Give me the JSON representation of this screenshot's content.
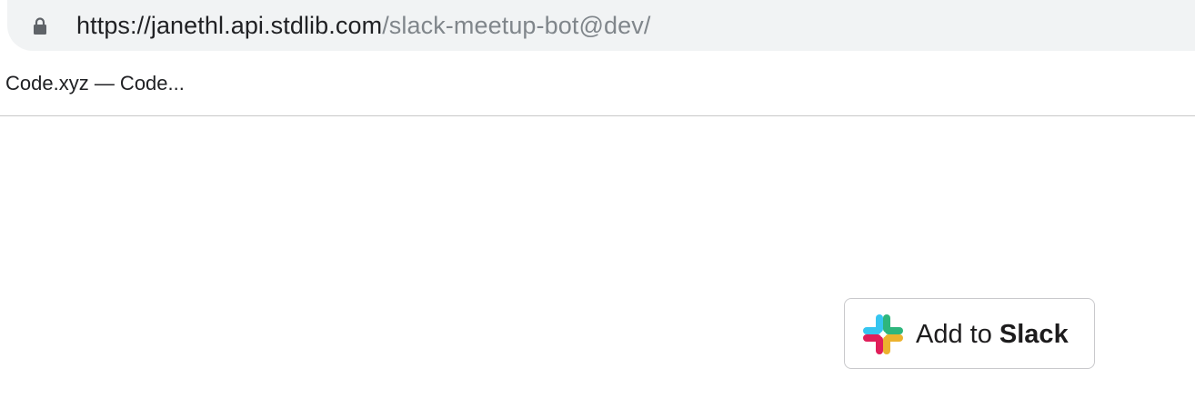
{
  "browser": {
    "url_host": "https://janethl.api.stdlib.com",
    "url_path": "/slack-meetup-bot@dev/",
    "lock_icon": "lock-icon"
  },
  "bookmarks": {
    "items": [
      {
        "label": "Code.xyz — Code..."
      }
    ]
  },
  "slack_button": {
    "prefix": "Add to ",
    "brand": "Slack",
    "icon": "slack-logo-icon",
    "colors": {
      "blue": "#36C5F0",
      "green": "#2EB67D",
      "red": "#E01E5A",
      "yellow": "#ECB22E"
    }
  }
}
